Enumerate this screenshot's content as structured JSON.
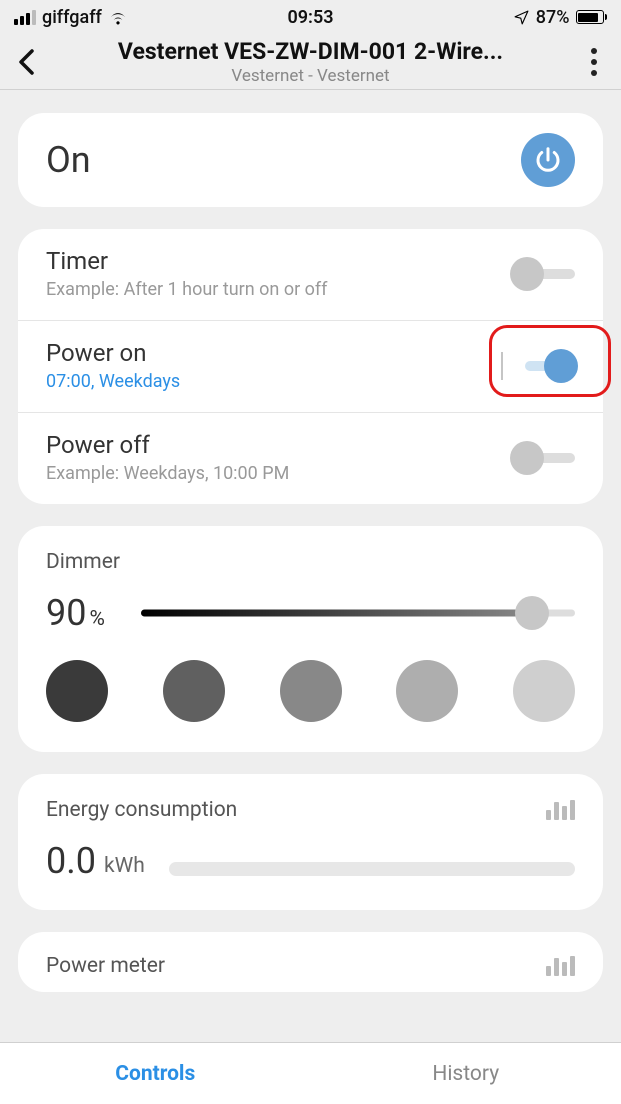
{
  "status": {
    "carrier": "giffgaff",
    "time": "09:53",
    "battery_pct": "87%"
  },
  "header": {
    "title": "Vesternet VES-ZW-DIM-001 2-Wire...",
    "subtitle": "Vesternet - Vesternet"
  },
  "on_card": {
    "state": "On"
  },
  "timer": {
    "rows": [
      {
        "title": "Timer",
        "sub": "Example: After 1 hour turn on or off",
        "active": false
      },
      {
        "title": "Power on",
        "sub": "07:00, Weekdays",
        "active": true
      },
      {
        "title": "Power off",
        "sub": "Example: Weekdays, 10:00 PM",
        "active": false
      }
    ]
  },
  "dimmer": {
    "label": "Dimmer",
    "value": "90",
    "pct_sign": "%",
    "presets": [
      "#3a3a3a",
      "#606060",
      "#888888",
      "#aeaeae",
      "#cfcfcf"
    ]
  },
  "energy": {
    "title": "Energy consumption",
    "value": "0.0",
    "unit": "kWh"
  },
  "power_meter": {
    "title": "Power meter"
  },
  "tabs": {
    "controls": "Controls",
    "history": "History"
  }
}
